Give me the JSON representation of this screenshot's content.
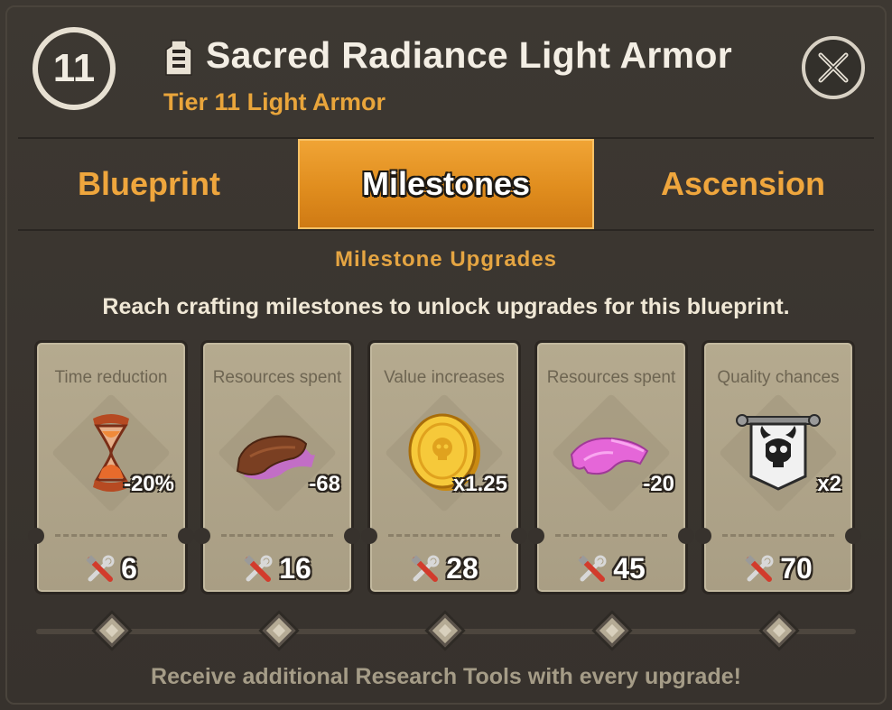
{
  "header": {
    "level": "11",
    "title": "Sacred Radiance Light Armor",
    "subtitle": "Tier 11 Light Armor",
    "item_icon": "light-armor-icon",
    "close_icon": "close-icon"
  },
  "tabs": [
    {
      "label": "Blueprint",
      "active": false
    },
    {
      "label": "Milestones",
      "active": true
    },
    {
      "label": "Ascension",
      "active": false
    }
  ],
  "section": {
    "title": "Milestone Upgrades",
    "description": "Reach crafting milestones to unlock upgrades for this blueprint."
  },
  "milestones": [
    {
      "label": "Time reduction",
      "icon": "hourglass-icon",
      "value": "-20%",
      "required": "6"
    },
    {
      "label": "Resources spent",
      "icon": "leather-icon",
      "value": "-68",
      "required": "16"
    },
    {
      "label": "Value increases",
      "icon": "gold-coin-icon",
      "value": "x1.25",
      "required": "28"
    },
    {
      "label": "Resources spent",
      "icon": "silk-cloth-icon",
      "value": "-20",
      "required": "45"
    },
    {
      "label": "Quality chances",
      "icon": "skull-banner-icon",
      "value": "x2",
      "required": "70"
    }
  ],
  "footer": "Receive additional Research Tools with every upgrade!",
  "colors": {
    "accent_orange": "#e9a53b",
    "active_tab": "#e08d1e",
    "card_bg": "#b5aa8f",
    "panel_bg": "#3a352f"
  }
}
